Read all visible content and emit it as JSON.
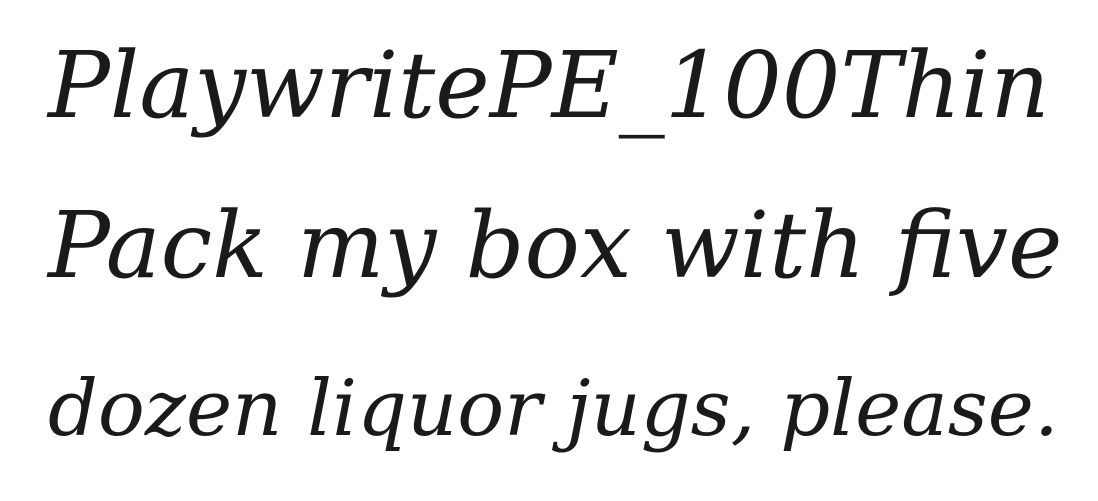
{
  "sample": {
    "font_name": "PlaywritePE_100Thin",
    "line_2": "Pack my box with five",
    "line_3": "dozen liquor jugs, please."
  },
  "colors": {
    "background": "#ffffff",
    "text": "#1a1a1a"
  }
}
